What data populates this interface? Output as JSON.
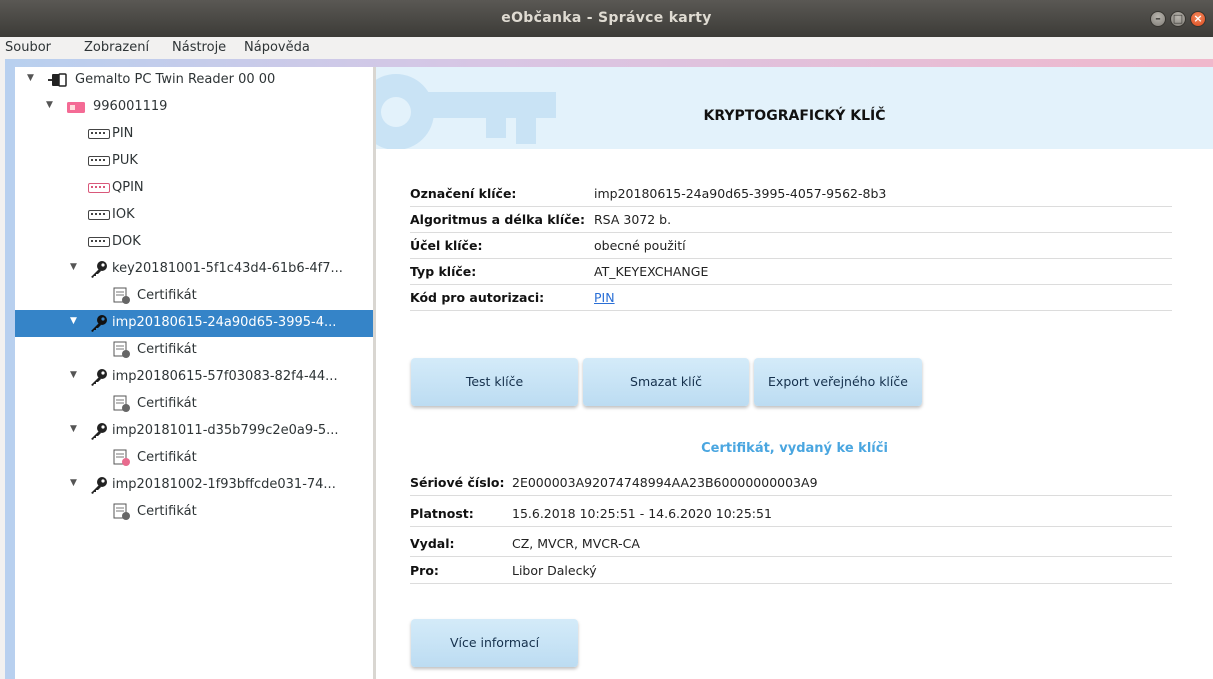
{
  "window": {
    "title": "eObčanka - Správce karty"
  },
  "menu": {
    "items": [
      {
        "label": "Soubor"
      },
      {
        "label": "Zobrazení"
      },
      {
        "label": "Nástroje"
      },
      {
        "label": "Nápověda"
      }
    ]
  },
  "tree": {
    "reader": "Gemalto PC Twin Reader 00 00",
    "card": "996001119",
    "codes": [
      "PIN",
      "PUK",
      "QPIN",
      "IOK",
      "DOK"
    ],
    "keys": [
      {
        "label": "key20181001-5f1c43d4-61b6-4f7...",
        "child": "Certifikát",
        "selected": false
      },
      {
        "label": "imp20180615-24a90d65-3995-4...",
        "child": "Certifikát",
        "selected": true
      },
      {
        "label": "imp20180615-57f03083-82f4-44...",
        "child": "Certifikát",
        "selected": false
      },
      {
        "label": "imp20181011-d35b799c2e0a9-5...",
        "child": "Certifikát",
        "selected": false
      },
      {
        "label": "imp20181002-1f93bffcde031-74...",
        "child": "Certifikát",
        "selected": false
      }
    ]
  },
  "detail": {
    "heading": "KRYPTOGRAFICKÝ KLÍČ",
    "key_info": [
      {
        "key": "Označení klíče:",
        "value": "imp20180615-24a90d65-3995-4057-9562-8b3"
      },
      {
        "key": "Algoritmus a délka klíče:",
        "value": "RSA 3072 b."
      },
      {
        "key": "Účel klíče:",
        "value": "obecné použití"
      },
      {
        "key": "Typ klíče:",
        "value": "AT_KEYEXCHANGE"
      },
      {
        "key": "Kód pro autorizaci:",
        "value": "PIN"
      }
    ],
    "buttons": {
      "test": "Test klíče",
      "delete": "Smazat klíč",
      "export": "Export veřejného klíče"
    },
    "cert_heading": "Certifikát, vydaný ke klíči",
    "cert_info": [
      {
        "key": "Sériové číslo:",
        "value": "2E000003A92074748994AA23B60000000003A9"
      },
      {
        "key": "Platnost:",
        "value": "15.6.2018 10:25:51 - 14.6.2020 10:25:51"
      },
      {
        "key": "Vydal:",
        "value": "CZ, MVCR, MVCR-CA"
      },
      {
        "key": "Pro:",
        "value": "Libor Dalecký"
      }
    ],
    "more_button": "Více informací"
  },
  "colors": {
    "selection": "#3584c8",
    "header_bg": "#e3f2fb",
    "accent_text": "#4aa6e0",
    "link": "#2a6fd6"
  }
}
